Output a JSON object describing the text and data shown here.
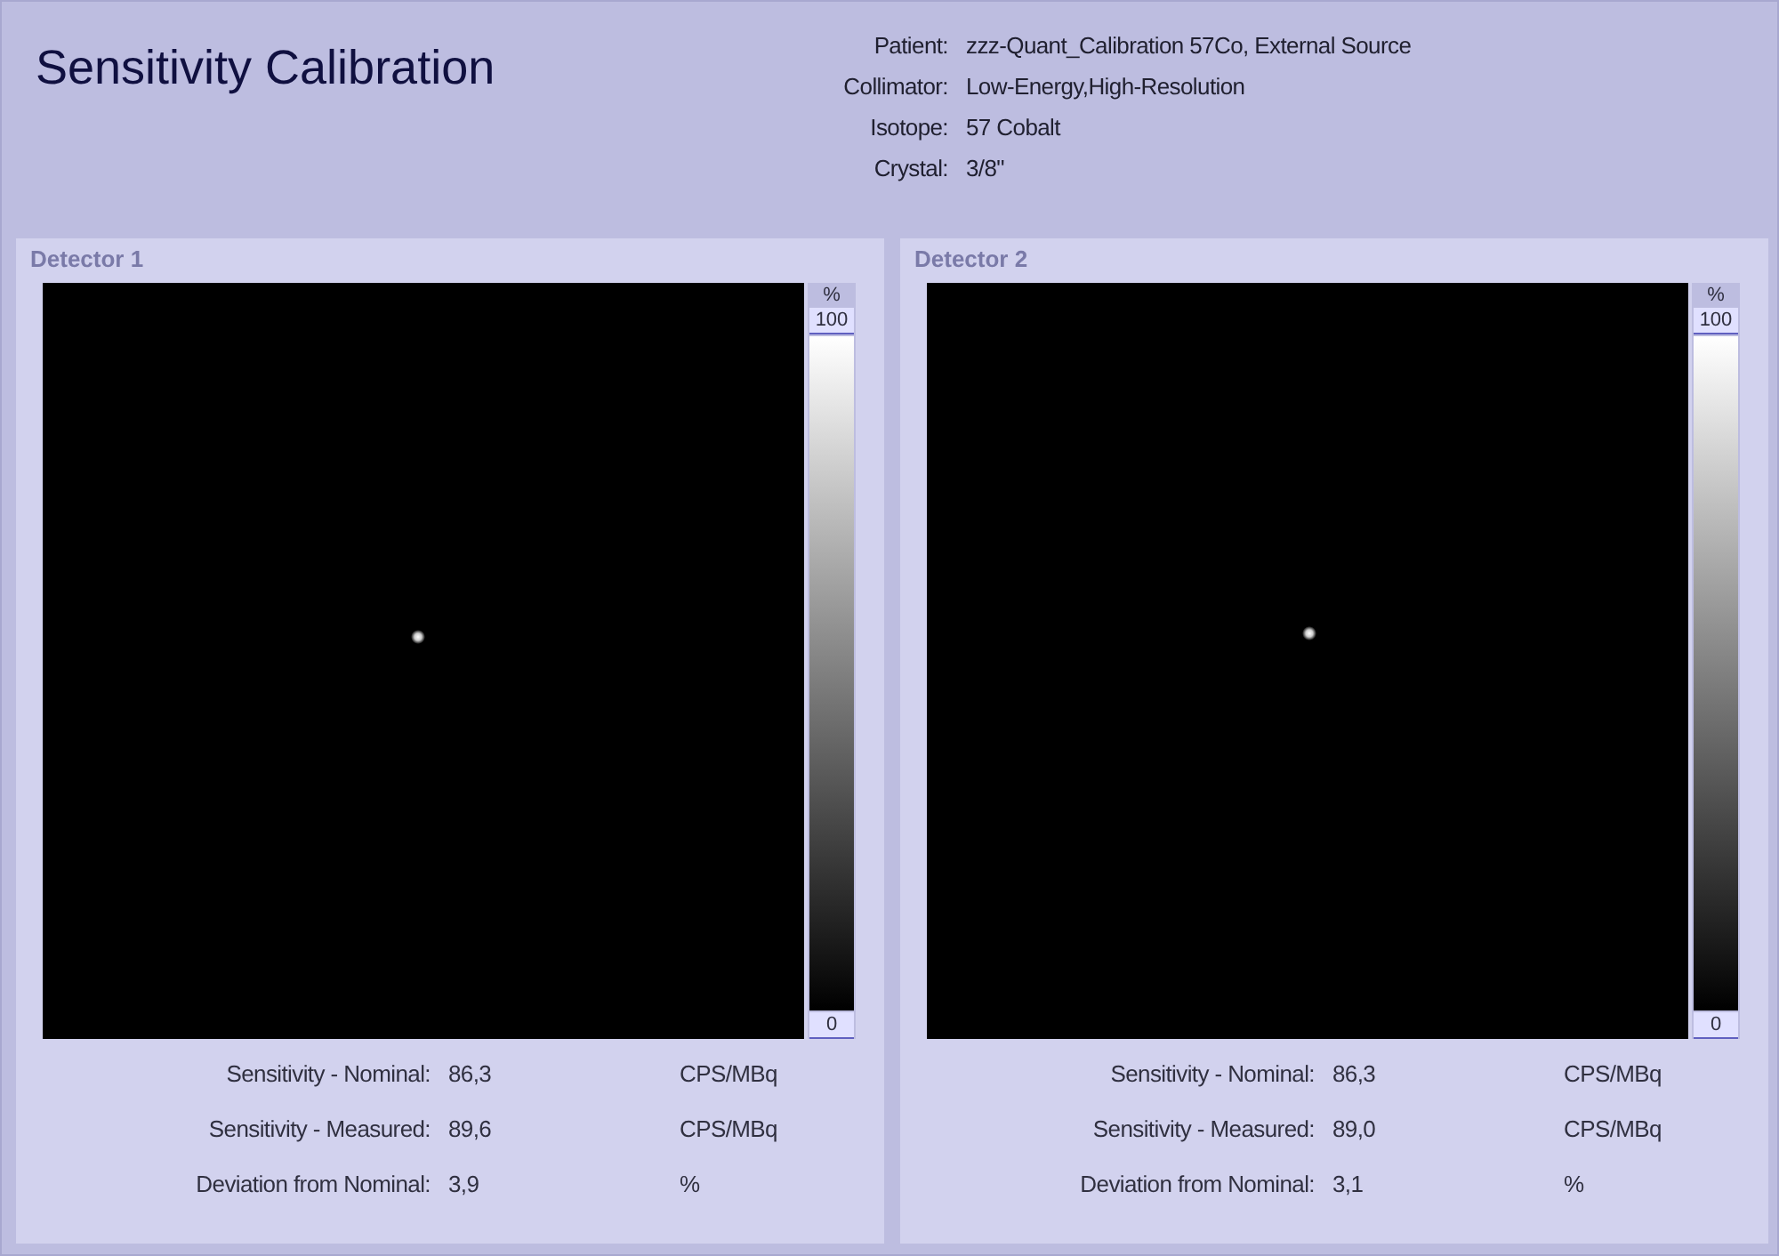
{
  "title": "Sensitivity Calibration",
  "info": [
    {
      "label": "Patient:",
      "value": "zzz-Quant_Calibration 57Co, External Source"
    },
    {
      "label": "Collimator:",
      "value": "Low-Energy,High-Resolution"
    },
    {
      "label": "Isotope:",
      "value": "57 Cobalt"
    },
    {
      "label": "Crystal:",
      "value": "3/8\""
    }
  ],
  "detectors": [
    {
      "title": "Detector 1",
      "scale_unit": "%",
      "scale_max": "100",
      "scale_min": "0",
      "results": [
        {
          "label": "Sensitivity - Nominal:",
          "value": "86,3",
          "unit": "CPS/MBq"
        },
        {
          "label": "Sensitivity - Measured:",
          "value": "89,6",
          "unit": "CPS/MBq"
        },
        {
          "label": "Deviation from Nominal:",
          "value": "3,9",
          "unit": "%"
        }
      ]
    },
    {
      "title": "Detector 2",
      "scale_unit": "%",
      "scale_max": "100",
      "scale_min": "0",
      "results": [
        {
          "label": "Sensitivity - Nominal:",
          "value": "86,3",
          "unit": "CPS/MBq"
        },
        {
          "label": "Sensitivity - Measured:",
          "value": "89,0",
          "unit": "CPS/MBq"
        },
        {
          "label": "Deviation from Nominal:",
          "value": "3,1",
          "unit": "%"
        }
      ]
    }
  ]
}
